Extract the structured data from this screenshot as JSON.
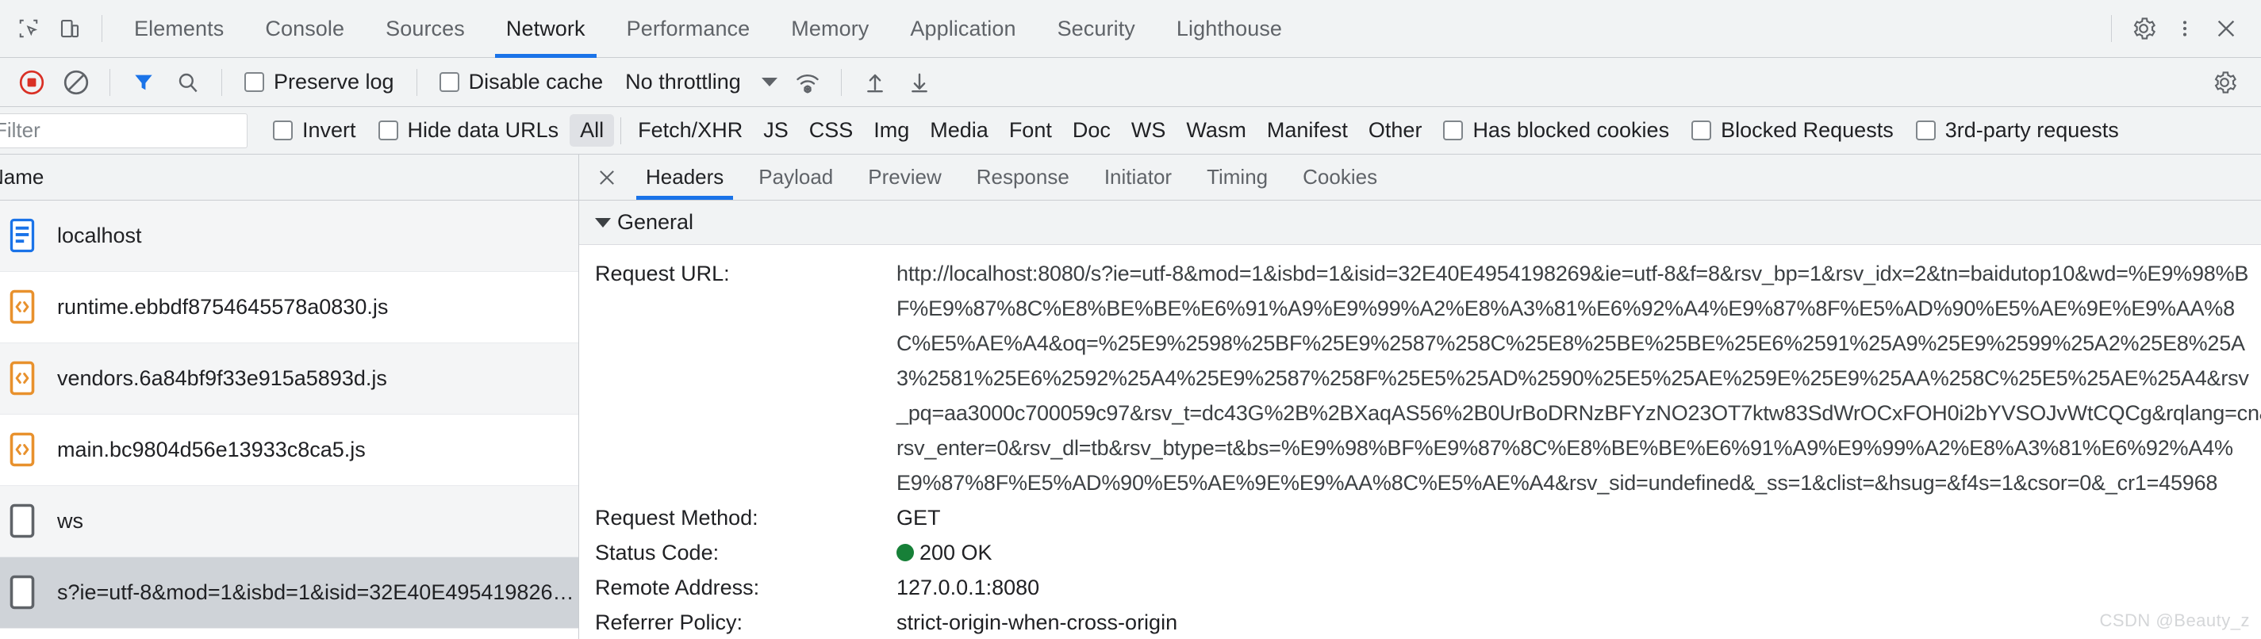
{
  "devtools": {
    "main_tabs": [
      {
        "label": "Elements",
        "active": false
      },
      {
        "label": "Console",
        "active": false
      },
      {
        "label": "Sources",
        "active": false
      },
      {
        "label": "Network",
        "active": true
      },
      {
        "label": "Performance",
        "active": false
      },
      {
        "label": "Memory",
        "active": false
      },
      {
        "label": "Application",
        "active": false
      },
      {
        "label": "Security",
        "active": false
      },
      {
        "label": "Lighthouse",
        "active": false
      }
    ],
    "icons": {
      "inspect": "inspect-element-icon",
      "device": "device-toolbar-icon",
      "settings": "gear-icon",
      "more": "more-vertical-icon",
      "close": "close-icon"
    }
  },
  "toolbar": {
    "record_label": "record-stop-button",
    "clear_label": "clear-button",
    "filter_toggle_label": "filter-funnel-button",
    "search_label": "search-button",
    "preserve_log": {
      "label": "Preserve log",
      "checked": false
    },
    "disable_cache": {
      "label": "Disable cache",
      "checked": false
    },
    "throttling": {
      "value": "No throttling"
    },
    "wifi_label": "network-conditions-icon",
    "import_label": "import-har-button",
    "export_label": "export-har-button",
    "settings_label": "network-settings-gear"
  },
  "filterbar": {
    "input_value": "",
    "input_placeholder": "Filter",
    "invert": {
      "label": "Invert",
      "checked": false
    },
    "hide_data_urls": {
      "label": "Hide data URLs",
      "checked": false
    },
    "types": [
      {
        "label": "All",
        "active": true
      },
      {
        "label": "Fetch/XHR",
        "active": false
      },
      {
        "label": "JS",
        "active": false
      },
      {
        "label": "CSS",
        "active": false
      },
      {
        "label": "Img",
        "active": false
      },
      {
        "label": "Media",
        "active": false
      },
      {
        "label": "Font",
        "active": false
      },
      {
        "label": "Doc",
        "active": false
      },
      {
        "label": "WS",
        "active": false
      },
      {
        "label": "Wasm",
        "active": false
      },
      {
        "label": "Manifest",
        "active": false
      },
      {
        "label": "Other",
        "active": false
      }
    ],
    "has_blocked_cookies": {
      "label": "Has blocked cookies",
      "checked": false
    },
    "blocked_requests": {
      "label": "Blocked Requests",
      "checked": false
    },
    "third_party_requests": {
      "label": "3rd-party requests",
      "checked": false
    }
  },
  "requests": {
    "column_header": "Name",
    "rows": [
      {
        "name": "localhost",
        "icon": "document-icon",
        "selected": false
      },
      {
        "name": "runtime.ebbdf8754645578a0830.js",
        "icon": "script-icon",
        "selected": false
      },
      {
        "name": "vendors.6a84bf9f33e915a5893d.js",
        "icon": "script-icon",
        "selected": false
      },
      {
        "name": "main.bc9804d56e13933c8ca5.js",
        "icon": "script-icon",
        "selected": false
      },
      {
        "name": "ws",
        "icon": "generic-icon",
        "selected": false
      },
      {
        "name": "s?ie=utf-8&mod=1&isbd=1&isid=32E40E495419826…",
        "icon": "generic-icon",
        "selected": true
      }
    ]
  },
  "details": {
    "tabs": [
      {
        "label": "Headers",
        "active": true
      },
      {
        "label": "Payload",
        "active": false
      },
      {
        "label": "Preview",
        "active": false
      },
      {
        "label": "Response",
        "active": false
      },
      {
        "label": "Initiator",
        "active": false
      },
      {
        "label": "Timing",
        "active": false
      },
      {
        "label": "Cookies",
        "active": false
      }
    ],
    "general_section": "General",
    "request_url_key": "Request URL:",
    "request_url_lines": [
      "http://localhost:8080/s?ie=utf-8&mod=1&isbd=1&isid=32E40E4954198269&ie=utf-8&f=8&rsv_bp=1&rsv_idx=2&tn=baidutop10&wd=%E9%98%B",
      "F%E9%87%8C%E8%BE%BE%E6%91%A9%E9%99%A2%E8%A3%81%E6%92%A4%E9%87%8F%E5%AD%90%E5%AE%9E%E9%AA%8",
      "C%E5%AE%A4&oq=%25E9%2598%25BF%25E9%2587%258C%25E8%25BE%25BE%25E6%2591%25A9%25E9%2599%25A2%25E8%25A",
      "3%2581%25E6%2592%25A4%25E9%2587%258F%25E5%25AD%2590%25E5%25AE%259E%25E9%25AA%258C%25E5%25AE%25A4&rsv",
      "_pq=aa3000c700059c97&rsv_t=dc43G%2B%2BXaqAS56%2B0UrBoDRNzBFYzNO23OT7ktw83SdWrOCxFOH0i2bYVSOJvWtCQCg&rqlang=cn&",
      "rsv_enter=0&rsv_dl=tb&rsv_btype=t&bs=%E9%98%BF%E9%87%8C%E8%BE%BE%E6%91%A9%E9%99%A2%E8%A3%81%E6%92%A4%",
      "E9%87%8F%E5%AD%90%E5%AE%9E%E9%AA%8C%E5%AE%A4&rsv_sid=undefined&_ss=1&clist=&hsug=&f4s=1&csor=0&_cr1=45968"
    ],
    "rows": [
      {
        "key": "Request Method:",
        "value": "GET",
        "dot": false
      },
      {
        "key": "Status Code:",
        "value": "200 OK",
        "dot": true,
        "dot_color": "#178038"
      },
      {
        "key": "Remote Address:",
        "value": "127.0.0.1:8080",
        "dot": false
      },
      {
        "key": "Referrer Policy:",
        "value": "strict-origin-when-cross-origin",
        "dot": false
      }
    ]
  },
  "watermark": "CSDN @Beauty_z",
  "colors": {
    "accent": "#1a73e8",
    "toolbar_bg": "#f1f3f4",
    "status_green": "#178038",
    "record_red": "#d93025",
    "script_orange": "#e8912d",
    "doc_blue": "#1a73e8",
    "selected_row": "#cfd3d8"
  }
}
